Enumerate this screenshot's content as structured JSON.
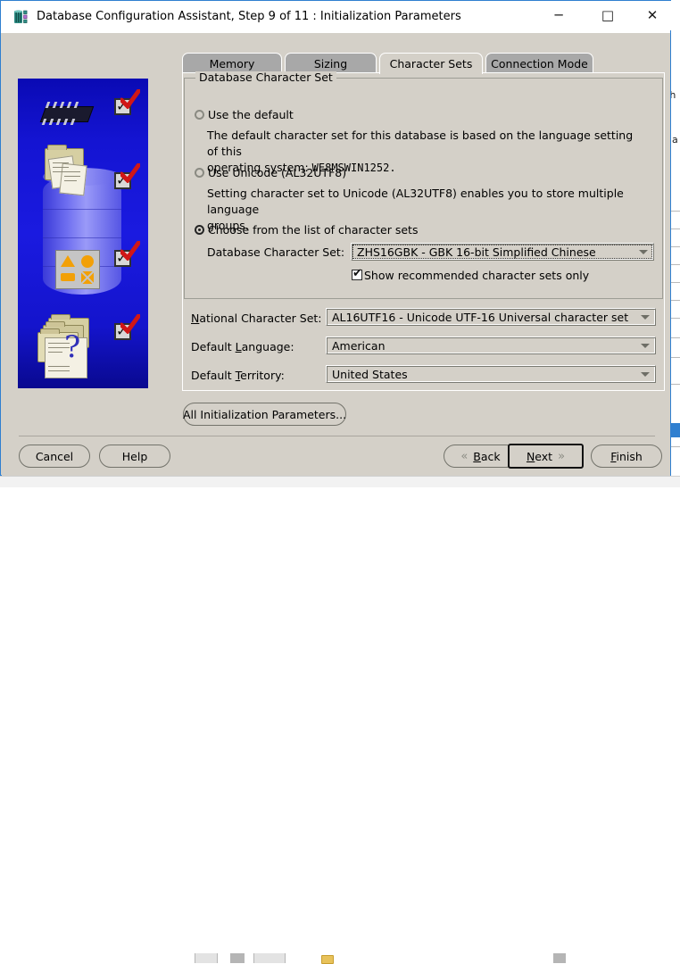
{
  "window": {
    "title": "Database Configuration Assistant, Step 9 of 11 : Initialization Parameters",
    "icon": "oracle-database-icon",
    "minimize_glyph": "─",
    "maximize_glyph": "□",
    "close_glyph": "✕",
    "titlebar_bg": "#ffffff",
    "dialog_bg": "#d4d0c8",
    "border_color": "#2f7fd0"
  },
  "tabs": [
    {
      "label": "Memory",
      "active": false
    },
    {
      "label": "Sizing",
      "active": false
    },
    {
      "label": "Character Sets",
      "active": true
    },
    {
      "label": "Connection Mode",
      "active": false
    }
  ],
  "group": {
    "title": "Database Character Set",
    "options": [
      {
        "id": "use-default",
        "label": "Use the default",
        "selected": false,
        "description_line1": "The default character set for this database is based on the language setting of this",
        "description_line2_prefix": "operating system: ",
        "description_line2_value": "WE8MSWIN1252."
      },
      {
        "id": "use-unicode",
        "label": "Use Unicode (AL32UTF8)",
        "selected": false,
        "description_line1": "Setting character set to Unicode (AL32UTF8) enables you to store multiple language",
        "description_line2_prefix": "groups.",
        "description_line2_value": ""
      },
      {
        "id": "choose-from-list",
        "label": "Choose from the list of character sets",
        "selected": true
      }
    ],
    "db_charset": {
      "label": "Database Character Set:",
      "value": "ZHS16GBK - GBK 16-bit Simplified Chinese",
      "focused": true
    },
    "show_recommended": {
      "label": "Show recommended character sets only",
      "checked": true,
      "check_glyph": "✔"
    }
  },
  "fields": [
    {
      "id": "national-charset",
      "label": "National Character Set:",
      "mnemonic": "N",
      "value": "AL16UTF16 - Unicode UTF-16 Universal character set"
    },
    {
      "id": "default-language",
      "label": "Default Language:",
      "mnemonic": "L",
      "value": "American"
    },
    {
      "id": "default-territory",
      "label": "Default Territory:",
      "mnemonic": "T",
      "value": "United States"
    }
  ],
  "buttons": {
    "all_params": "All Initialization Parameters...",
    "cancel": "Cancel",
    "help": "Help",
    "back": "Back",
    "back_mnemonic": "B",
    "back_chevron": "«",
    "next": "Next",
    "next_mnemonic": "N",
    "next_chevron": "»",
    "finish": "Finish",
    "finish_mnemonic": "F"
  },
  "banner": {
    "alt": "oracle-wizard-progress-artwork",
    "steps_checked": 4,
    "bg_start": "#0a0ab4",
    "bg_end": "#09098f"
  },
  "background": {
    "fragment_1": "th",
    "fragment_2": "ua",
    "selected_row_color": "#2f7fd0"
  }
}
